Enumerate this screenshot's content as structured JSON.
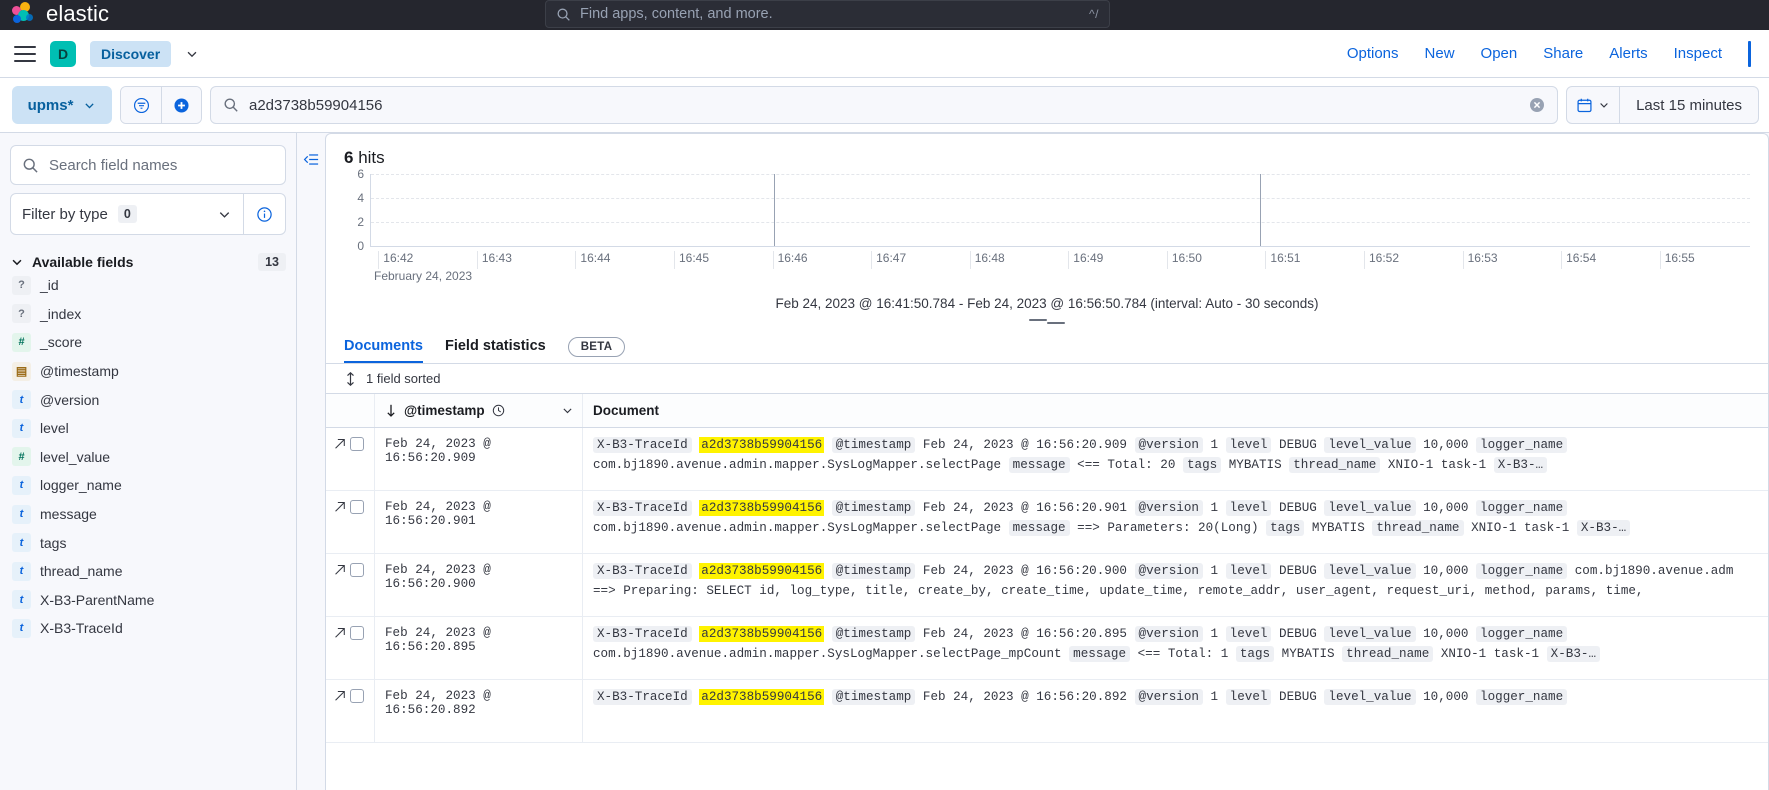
{
  "topbar": {
    "brand": "elastic",
    "brand_logo_icon": "elastic-logo-icon",
    "global_search_placeholder": "Find apps, content, and more.",
    "global_search_shortcut": "^/",
    "search_icon": "search-icon"
  },
  "appnav": {
    "menu_icon": "hamburger-menu-icon",
    "space_initial": "D",
    "app_name": "Discover",
    "chevron_icon": "chevron-down-icon",
    "links": [
      "Options",
      "New",
      "Open",
      "Share",
      "Alerts",
      "Inspect"
    ]
  },
  "querybar": {
    "data_view": "upms*",
    "data_view_chevron": "chevron-down-icon",
    "filter_icon": "filter-list-icon",
    "add_filter_icon": "plus-circle-icon",
    "search_icon": "search-icon",
    "query": "a2d3738b59904156",
    "clear_icon": "clear-cross-icon",
    "calendar_icon": "calendar-icon",
    "calendar_chevron": "chevron-down-icon",
    "date_range": "Last 15 minutes"
  },
  "sidebar": {
    "search_placeholder": "Search field names",
    "search_icon": "search-icon",
    "filter_by_type_label": "Filter by type",
    "filter_by_type_count": "0",
    "filter_chevron_icon": "chevron-down-icon",
    "info_icon": "info-circle-icon",
    "available_fields_label": "Available fields",
    "available_fields_count": "13",
    "collapse_icon": "chevron-down-icon",
    "fields": [
      {
        "name": "_id",
        "type": "q"
      },
      {
        "name": "_index",
        "type": "q"
      },
      {
        "name": "_score",
        "type": "num"
      },
      {
        "name": "@timestamp",
        "type": "date"
      },
      {
        "name": "@version",
        "type": "t"
      },
      {
        "name": "level",
        "type": "t"
      },
      {
        "name": "level_value",
        "type": "num"
      },
      {
        "name": "logger_name",
        "type": "t"
      },
      {
        "name": "message",
        "type": "t"
      },
      {
        "name": "tags",
        "type": "t"
      },
      {
        "name": "thread_name",
        "type": "t"
      },
      {
        "name": "X-B3-ParentName",
        "type": "t"
      },
      {
        "name": "X-B3-TraceId",
        "type": "t"
      }
    ]
  },
  "main": {
    "collapse_sidebar_icon": "collapse-panel-icon",
    "hits_count": "6",
    "hits_label": "hits",
    "chart_subtitle": "Feb 24, 2023 @ 16:41:50.784 - Feb 24, 2023 @ 16:56:50.784 (interval: Auto - 30 seconds)",
    "resize_handle_icon": "resize-grab-icon",
    "tabs": [
      {
        "label": "Documents",
        "selected": true
      },
      {
        "label": "Field statistics",
        "selected": false
      }
    ],
    "beta_badge": "BETA",
    "sort_icon": "sort-updown-icon",
    "sort_label": "1 field sorted",
    "columns": {
      "timestamp": "@timestamp",
      "timestamp_sort_icon": "arrow-down-icon",
      "timestamp_clock_icon": "clock-icon",
      "timestamp_menu_icon": "chevron-down-icon",
      "document": "Document"
    },
    "expand_icon": "expand-arrow-icon",
    "rows": [
      {
        "timestamp": "Feb 24, 2023 @ 16:56:20.909",
        "segments": [
          {
            "t": "X-B3-TraceId",
            "k": true
          },
          {
            "t": "a2d3738b59904156",
            "hl": true
          },
          {
            "t": "@timestamp",
            "k": true
          },
          {
            "t": "Feb 24, 2023 @ 16:56:20.909"
          },
          {
            "t": "@version",
            "k": true
          },
          {
            "t": "1"
          },
          {
            "t": "level",
            "k": true
          },
          {
            "t": "DEBUG"
          },
          {
            "t": "level_value",
            "k": true
          },
          {
            "t": "10,000"
          },
          {
            "t": "logger_name",
            "k": true
          },
          {
            "t": "com.bj1890.avenue.admin.mapper.SysLogMapper.selectPage"
          },
          {
            "t": "message",
            "k": true
          },
          {
            "t": "<== Total: 20"
          },
          {
            "t": "tags",
            "k": true
          },
          {
            "t": "MYBATIS"
          },
          {
            "t": "thread_name",
            "k": true
          },
          {
            "t": "XNIO-1 task-1"
          },
          {
            "t": "X-B3-…",
            "k": true
          }
        ]
      },
      {
        "timestamp": "Feb 24, 2023 @ 16:56:20.901",
        "segments": [
          {
            "t": "X-B3-TraceId",
            "k": true
          },
          {
            "t": "a2d3738b59904156",
            "hl": true
          },
          {
            "t": "@timestamp",
            "k": true
          },
          {
            "t": "Feb 24, 2023 @ 16:56:20.901"
          },
          {
            "t": "@version",
            "k": true
          },
          {
            "t": "1"
          },
          {
            "t": "level",
            "k": true
          },
          {
            "t": "DEBUG"
          },
          {
            "t": "level_value",
            "k": true
          },
          {
            "t": "10,000"
          },
          {
            "t": "logger_name",
            "k": true
          },
          {
            "t": "com.bj1890.avenue.admin.mapper.SysLogMapper.selectPage"
          },
          {
            "t": "message",
            "k": true
          },
          {
            "t": "==> Parameters: 20(Long)"
          },
          {
            "t": "tags",
            "k": true
          },
          {
            "t": "MYBATIS"
          },
          {
            "t": "thread_name",
            "k": true
          },
          {
            "t": "XNIO-1 task-1"
          },
          {
            "t": "X-B3-…",
            "k": true
          }
        ]
      },
      {
        "timestamp": "Feb 24, 2023 @ 16:56:20.900",
        "segments": [
          {
            "t": "X-B3-TraceId",
            "k": true
          },
          {
            "t": "a2d3738b59904156",
            "hl": true
          },
          {
            "t": "@timestamp",
            "k": true
          },
          {
            "t": "Feb 24, 2023 @ 16:56:20.900"
          },
          {
            "t": "@version",
            "k": true
          },
          {
            "t": "1"
          },
          {
            "t": "level",
            "k": true
          },
          {
            "t": "DEBUG"
          },
          {
            "t": "level_value",
            "k": true
          },
          {
            "t": "10,000"
          },
          {
            "t": "logger_name",
            "k": true
          },
          {
            "t": "com.bj1890.avenue.adm"
          },
          {
            "t": "==> Preparing: SELECT id, log_type, title, create_by, create_time, update_time, remote_addr, user_agent, request_uri, method, params, time,"
          }
        ]
      },
      {
        "timestamp": "Feb 24, 2023 @ 16:56:20.895",
        "segments": [
          {
            "t": "X-B3-TraceId",
            "k": true
          },
          {
            "t": "a2d3738b59904156",
            "hl": true
          },
          {
            "t": "@timestamp",
            "k": true
          },
          {
            "t": "Feb 24, 2023 @ 16:56:20.895"
          },
          {
            "t": "@version",
            "k": true
          },
          {
            "t": "1"
          },
          {
            "t": "level",
            "k": true
          },
          {
            "t": "DEBUG"
          },
          {
            "t": "level_value",
            "k": true
          },
          {
            "t": "10,000"
          },
          {
            "t": "logger_name",
            "k": true
          },
          {
            "t": "com.bj1890.avenue.admin.mapper.SysLogMapper.selectPage_mpCount"
          },
          {
            "t": "message",
            "k": true
          },
          {
            "t": "<== Total: 1"
          },
          {
            "t": "tags",
            "k": true
          },
          {
            "t": "MYBATIS"
          },
          {
            "t": "thread_name",
            "k": true
          },
          {
            "t": "XNIO-1 task-1"
          },
          {
            "t": "X-B3-…",
            "k": true
          }
        ]
      },
      {
        "timestamp": "Feb 24, 2023 @ 16:56:20.892",
        "segments": [
          {
            "t": "X-B3-TraceId",
            "k": true
          },
          {
            "t": "a2d3738b59904156",
            "hl": true
          },
          {
            "t": "@timestamp",
            "k": true
          },
          {
            "t": "Feb 24, 2023 @ 16:56:20.892"
          },
          {
            "t": "@version",
            "k": true
          },
          {
            "t": "1"
          },
          {
            "t": "level",
            "k": true
          },
          {
            "t": "DEBUG"
          },
          {
            "t": "level_value",
            "k": true
          },
          {
            "t": "10,000"
          },
          {
            "t": "logger_name",
            "k": true
          }
        ]
      }
    ]
  },
  "chart_data": {
    "type": "bar",
    "title": "6 hits",
    "xlabel": "",
    "ylabel": "",
    "ylim": [
      0,
      6
    ],
    "yticks": [
      0,
      2,
      4,
      6
    ],
    "grid": true,
    "axis_date_label": "February 24, 2023",
    "categories": [
      "16:42",
      "16:43",
      "16:44",
      "16:45",
      "16:46",
      "16:47",
      "16:48",
      "16:49",
      "16:50",
      "16:51",
      "16:52",
      "16:53",
      "16:54",
      "16:55"
    ],
    "values": [
      0,
      0,
      0,
      0,
      0,
      0,
      0,
      0,
      0,
      0,
      0,
      0,
      0,
      0
    ],
    "annotations": [
      {
        "label": "vertical marker",
        "x": "16:44:50"
      },
      {
        "label": "vertical marker",
        "x": "16:49:50"
      }
    ],
    "interval": "Auto - 30 seconds",
    "time_range_start": "Feb 24, 2023 @ 16:41:50.784",
    "time_range_end": "Feb 24, 2023 @ 16:56:50.784"
  }
}
